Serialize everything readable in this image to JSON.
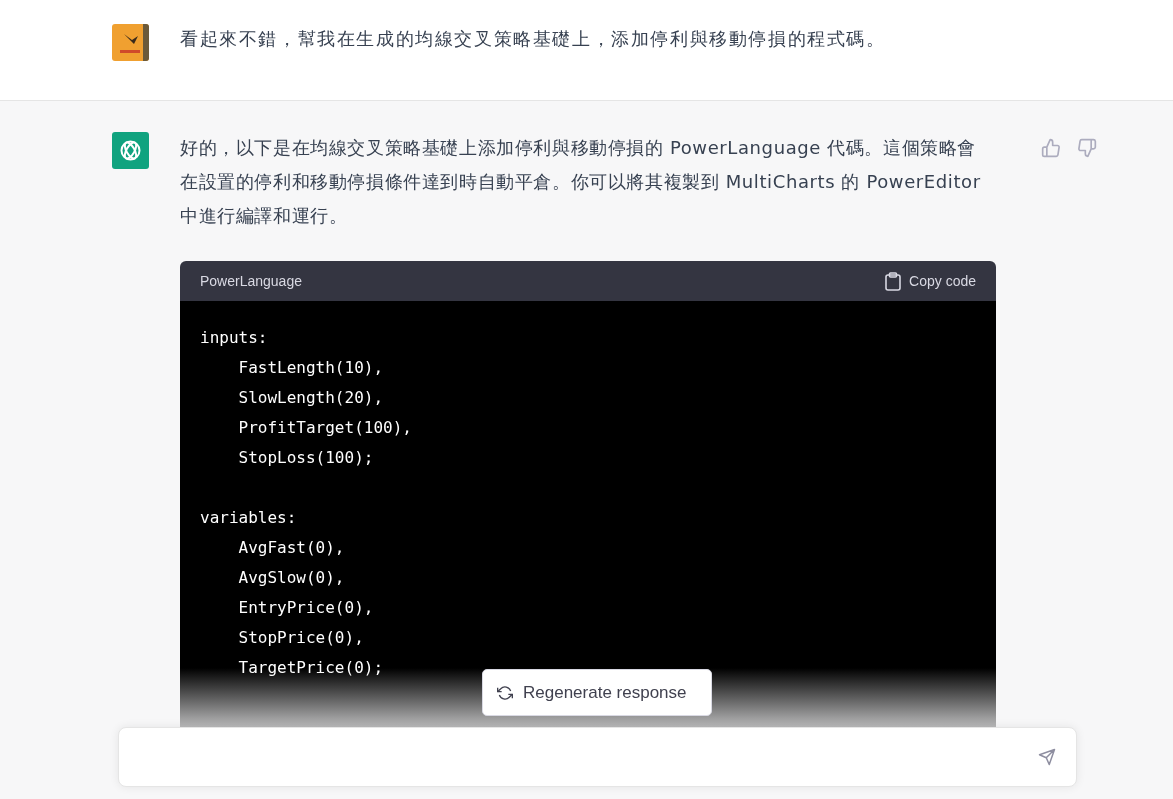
{
  "user_message": {
    "text": "看起來不錯，幫我在生成的均線交叉策略基礎上，添加停利與移動停損的程式碼。"
  },
  "assistant_message": {
    "paragraph": "好的，以下是在均線交叉策略基礎上添加停利與移動停損的 PowerLanguage 代碼。這個策略會在設置的停利和移動停損條件達到時自動平倉。你可以將其複製到 MultiCharts 的 PowerEditor 中進行編譯和運行。",
    "code_block": {
      "language": "PowerLanguage",
      "copy_label": "Copy code",
      "blocks": [
        [
          "inputs:",
          "    FastLength(10),",
          "    SlowLength(20),",
          "    ProfitTarget(100),",
          "    StopLoss(100);"
        ],
        [
          "variables:",
          "    AvgFast(0),",
          "    AvgSlow(0),",
          "    EntryPrice(0),",
          "    StopPrice(0),",
          "    TargetPrice(0);"
        ]
      ]
    }
  },
  "regenerate_button": "Regenerate response"
}
